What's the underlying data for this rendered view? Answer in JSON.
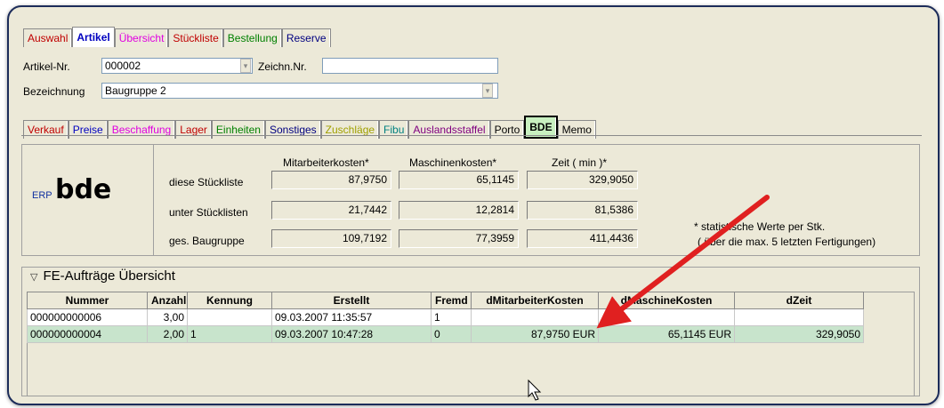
{
  "main_tabs": [
    {
      "label": "Auswahl",
      "color": "#c00000",
      "active": false
    },
    {
      "label": "Artikel",
      "color": "#0000c0",
      "active": true
    },
    {
      "label": "Übersicht",
      "color": "#e000e0",
      "active": false
    },
    {
      "label": "Stückliste",
      "color": "#c00000",
      "active": false
    },
    {
      "label": "Bestellung",
      "color": "#008000",
      "active": false
    },
    {
      "label": "Reserve",
      "color": "#000080",
      "active": false
    }
  ],
  "article": {
    "nr_label": "Artikel-Nr.",
    "nr_value": "000002",
    "zeichn_label": "Zeichn.Nr.",
    "zeichn_value": "",
    "bez_label": "Bezeichnung",
    "bez_value": "Baugruppe 2"
  },
  "sub_tabs": [
    {
      "label": "Verkauf",
      "color": "#c00000",
      "active": false
    },
    {
      "label": "Preise",
      "color": "#0000c0",
      "active": false
    },
    {
      "label": "Beschaffung",
      "color": "#e000e0",
      "active": false
    },
    {
      "label": "Lager",
      "color": "#c00000",
      "active": false
    },
    {
      "label": "Einheiten",
      "color": "#008000",
      "active": false
    },
    {
      "label": "Sonstiges",
      "color": "#000080",
      "active": false
    },
    {
      "label": "Zuschläge",
      "color": "#a0a000",
      "active": false
    },
    {
      "label": "Fibu",
      "color": "#008080",
      "active": false
    },
    {
      "label": "Auslandsstaffel",
      "color": "#800080",
      "active": false
    },
    {
      "label": "Porto",
      "color": "#000000",
      "active": false
    },
    {
      "label": "BDE",
      "color": "#000000",
      "active": true
    },
    {
      "label": "Memo",
      "color": "#000000",
      "active": false
    }
  ],
  "bde": {
    "logo_small": "ERP",
    "logo_big": "bde",
    "col_headers": [
      "Mitarbeiterkosten*",
      "Maschinenkosten*",
      "Zeit ( min )*"
    ],
    "rows": [
      {
        "label": "diese Stückliste",
        "values": [
          "87,9750",
          "65,1145",
          "329,9050"
        ]
      },
      {
        "label": "unter Stücklisten",
        "values": [
          "21,7442",
          "12,2814",
          "81,5386"
        ]
      },
      {
        "label": "ges. Baugruppe",
        "values": [
          "109,7192",
          "77,3959",
          "411,4436"
        ]
      }
    ],
    "note_line1": "* statistische Werte per Stk.",
    "note_line2": "( über die max. 5 letzten Fertigungen)"
  },
  "orders": {
    "title": "FE-Aufträge Übersicht",
    "columns": [
      "Nummer",
      "Anzahl",
      "Kennung",
      "Erstellt",
      "Fremd",
      "dMitarbeiterKosten",
      "dMaschineKosten",
      "dZeit"
    ],
    "rows": [
      [
        "000000000006",
        "3,00",
        "",
        "09.03.2007 11:35:57",
        "1",
        "",
        "",
        ""
      ],
      [
        "000000000004",
        "2,00",
        "1",
        "09.03.2007 10:47:28",
        "0",
        "87,9750 EUR",
        "65,1145 EUR",
        "329,9050"
      ]
    ],
    "selected_row": 1
  },
  "colors": {
    "arrow": "#e02020",
    "selected_row": "#c8e4cc"
  }
}
